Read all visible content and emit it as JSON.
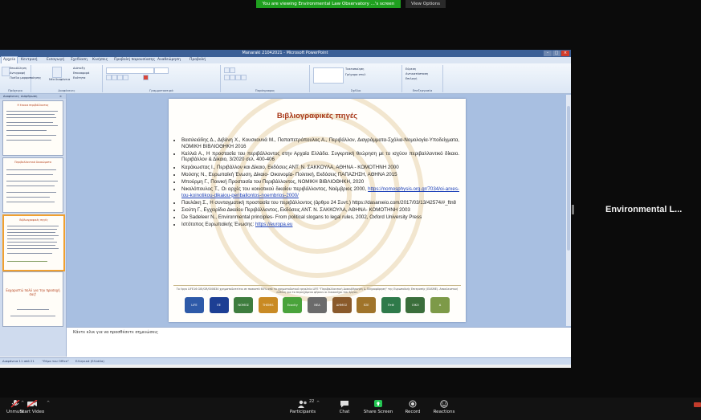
{
  "zoom": {
    "share_banner": "You are viewing Environmental Law Observatory ...'s screen",
    "view_options": "View Options",
    "participant_name": "Environmental L...",
    "toolbar": {
      "unmute": "Unmute",
      "start_video": "Start Video",
      "participants": "Participants",
      "participants_count": "22",
      "chat": "Chat",
      "share_screen": "Share Screen",
      "record": "Record",
      "reactions": "Reactions"
    }
  },
  "ppt": {
    "title": "Manaraki 21042021 - Microsoft PowerPoint",
    "tabs": [
      "Αρχείο",
      "Κεντρική",
      "Εισαγωγή",
      "Σχεδίαση",
      "Κινήσεις",
      "Προβολή παρουσίασης",
      "Αναθεώρηση",
      "Προβολή"
    ],
    "ribbon_groups": [
      "Πρόχειρο",
      "Διαφάνειες",
      "Γραμματοσειρά",
      "Παράγραφος",
      "Σχέδιο",
      "Επεξεργασία"
    ],
    "ribbon_items": {
      "paste": "Επικόλληση",
      "new_slide": "Νέα διαφάνεια",
      "layout": "Διάταξη",
      "reset": "Επαναφορά",
      "section": "Ενότητα",
      "cut": "Αποκοπή",
      "copy": "Αντιγραφή",
      "format_painter": "Πινέλο μορφοποίησης",
      "arrange": "Τακτοποίηση",
      "quick_styles": "Γρήγορα στυλ",
      "find": "Εύρεση",
      "replace": "Αντικατάσταση",
      "select": "Επιλογή"
    },
    "panel_tabs": [
      "Διαφάνειες",
      "Διάρθρωση"
    ],
    "thumbs": [
      {
        "title": "Η έννοια περιβάλλοντος"
      },
      {
        "title": "Περιβαλλοντικά δικαιώματα"
      },
      {
        "title": "Βιβλιογραφικές πηγές"
      },
      {
        "title": "Ευχαριστώ πολύ για την προσοχή σας!"
      }
    ],
    "slide": {
      "title": "Βιβλιογραφικές πηγές",
      "refs": [
        "Βασιλειάδης Δ., Διβάνη Χ., Κουσκουνά Μ., Παπαπετρόπουλος Α., Περιβάλλον, Διαγράμματα-Σχόλια-Νομολογία-Υποδείγματα, ΝΟΜΙΚΗ ΒΙΒΛΙΟΘΗΚΗ 2016",
        "Καλλιά Α., Η προστασία του περιβάλλοντος στην Αρχαία Ελλάδα. Συγκριτική θεώρηση με το ισχύον περιβαλλοντικό δίκαιο. Περιβάλλον & Δίκαιο, 3/2020 σελ. 400-406",
        "Καράκωστας Ι., Περιβάλλον και Δίκαιο, Εκδόσεις ΑΝΤ. Ν. ΣΑΚΚΟΥΛΑ, ΑΘΗΝΑ - ΚΟΜΟΤΗΝΗ 2000",
        "Μούσης Ν., Ευρωπαϊκή Ένωση, Δίκαιο- Οικονομία- Πολιτική, Εκδόσεις ΠΑΠΑΖΗΣΗ, ΑΘΗΝΑ 2015",
        "Μπούρμη Γ., Ποινική Προστασία του Περιβάλλοντος, ΝΟΜΙΚΗ ΒΙΒΛΙΟΘΗΚΗ, 2020",
        "Νικολόπουλος Τ., Οι αρχές του κοινοτικού δικαίου περιβάλλοντος, Νοέμβριος 2000,",
        "Παυλάκη Σ., Η συνταγματική προστασία του περιβάλλοντος (άρθρο 24 Συντ.) https://dasarxeio.com/2017/03/13/42574/#_ftn8",
        "Σιούτη Γ., Εγχειρίδιο Δικαίου Περιβάλλοντος, Εκδόσεις ΑΝΤ. Ν. ΣΑΚΚΟΥΛΑ, ΑΘΗΝΑ- ΚΟΜΟΤΗΝΗ 2003",
        "De Sadeleer N., Environmental principles- From political slogans to legal rules, 2002, Oxford University Press",
        "Ιστότοπος Ευρωπαϊκής Ένωσης:"
      ],
      "ref6_link": "https://nomosphysis.org.gr/7034/oi-arxes-tou-koinotikou-dikaiou-periballontos-noembrios-2000/",
      "ref10_link": "https://europa.eu",
      "funding_text": "Το έργο LIFE16 GIE/GR/000834 χρηματοδοτείται σε ποσοστό 60% από το χρηματοδοτικό εργαλείο LIFE \"Περιβαλλοντική Διακυβέρνηση & Πληροφόρηση\" της Ευρωπαϊκής Επιτροπής (EASME). Αποκλειστική ευθύνη για το περιεχόμενο φέρουν οι δικαιούχοι του έργου.",
      "logos": [
        "LIFE",
        "ΕΕ",
        "ΝΟΜΟΣ",
        "THEMIS",
        "Ecocity",
        "ΝΕΑ",
        "ΔΗΜΟΣ",
        "ΕΣΕ",
        "ΠτΦ",
        "ΟΙΚΟ",
        "Α"
      ]
    },
    "notes_placeholder": "Κάντε κλικ για να προσθέσετε σημειώσεις",
    "status": {
      "slide": "Διαφάνεια 11 από 21",
      "theme": "\"Θέμα του Office\"",
      "language": "Ελληνικά (Ελλάδα)"
    }
  }
}
